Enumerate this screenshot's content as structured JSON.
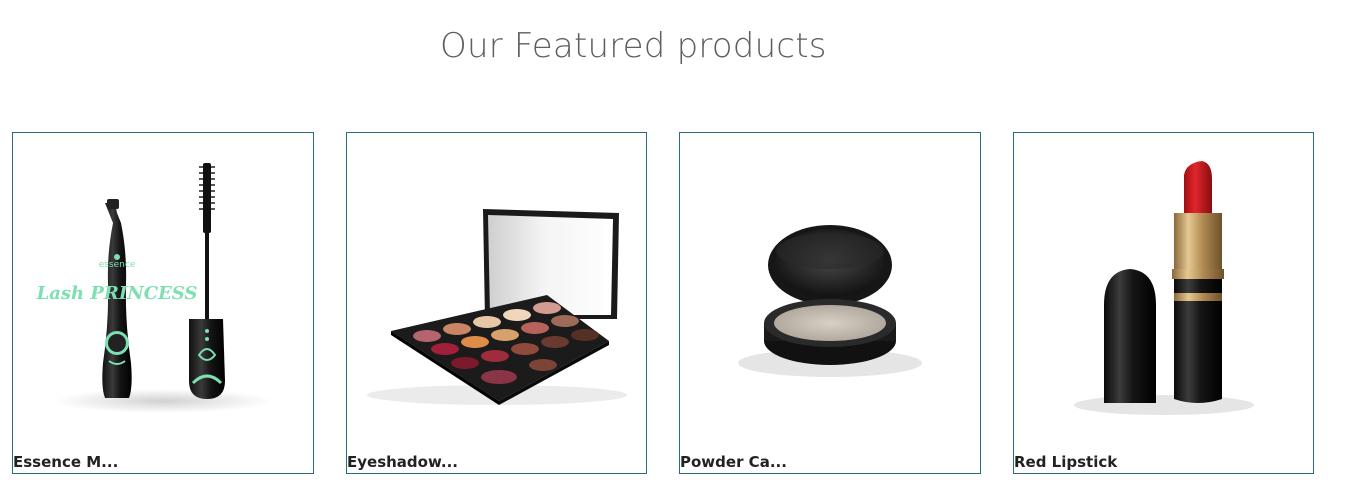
{
  "section": {
    "title": "Our Featured products"
  },
  "products": [
    {
      "name": "Essence M...",
      "image": "mascara-image"
    },
    {
      "name": "Eyeshadow...",
      "image": "eyeshadow-palette-image"
    },
    {
      "name": "Powder Ca...",
      "image": "powder-compact-image"
    },
    {
      "name": "Red Lipstick",
      "image": "lipstick-image"
    }
  ],
  "colors": {
    "card_border": "#2b6b80",
    "title": "#5e5e5e",
    "name": "#222222"
  },
  "mascara_brand": "essence",
  "mascara_line": "Lash PRINCESS",
  "mascara_tag": "false lash effect mascara"
}
